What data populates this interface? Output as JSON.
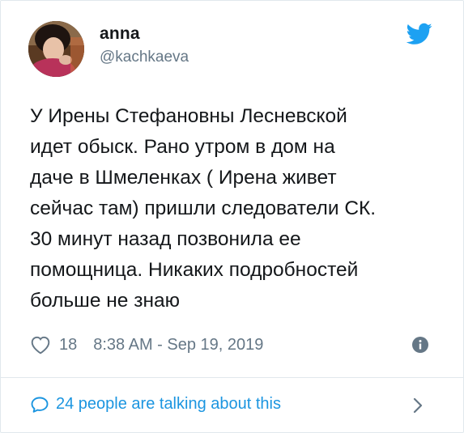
{
  "tweet": {
    "author_name": "anna",
    "author_handle": "@kachkaeva",
    "text": "У Ирены Стефановны Лесневской\nидет обыск. Рано утром в дом на\nдаче в Шмеленках ( Ирена живет\nсейчас там) пришли следователи СК.\n30 минут назад позвонила ее\nпомощница. Никаких подробностей\nбольше не знаю",
    "likes": "18",
    "timestamp": "8:38 AM - Sep 19, 2019",
    "talking": "24 people are talking about this"
  },
  "colors": {
    "accent": "#1da1f2",
    "link": "#1b95e0",
    "muted": "#657786",
    "text": "#14171a",
    "border": "#e1e8ed"
  },
  "icons": {
    "brand": "twitter-bird-icon",
    "like": "heart-icon",
    "info": "info-icon",
    "reply": "speech-bubble-icon",
    "more": "chevron-right-icon"
  }
}
